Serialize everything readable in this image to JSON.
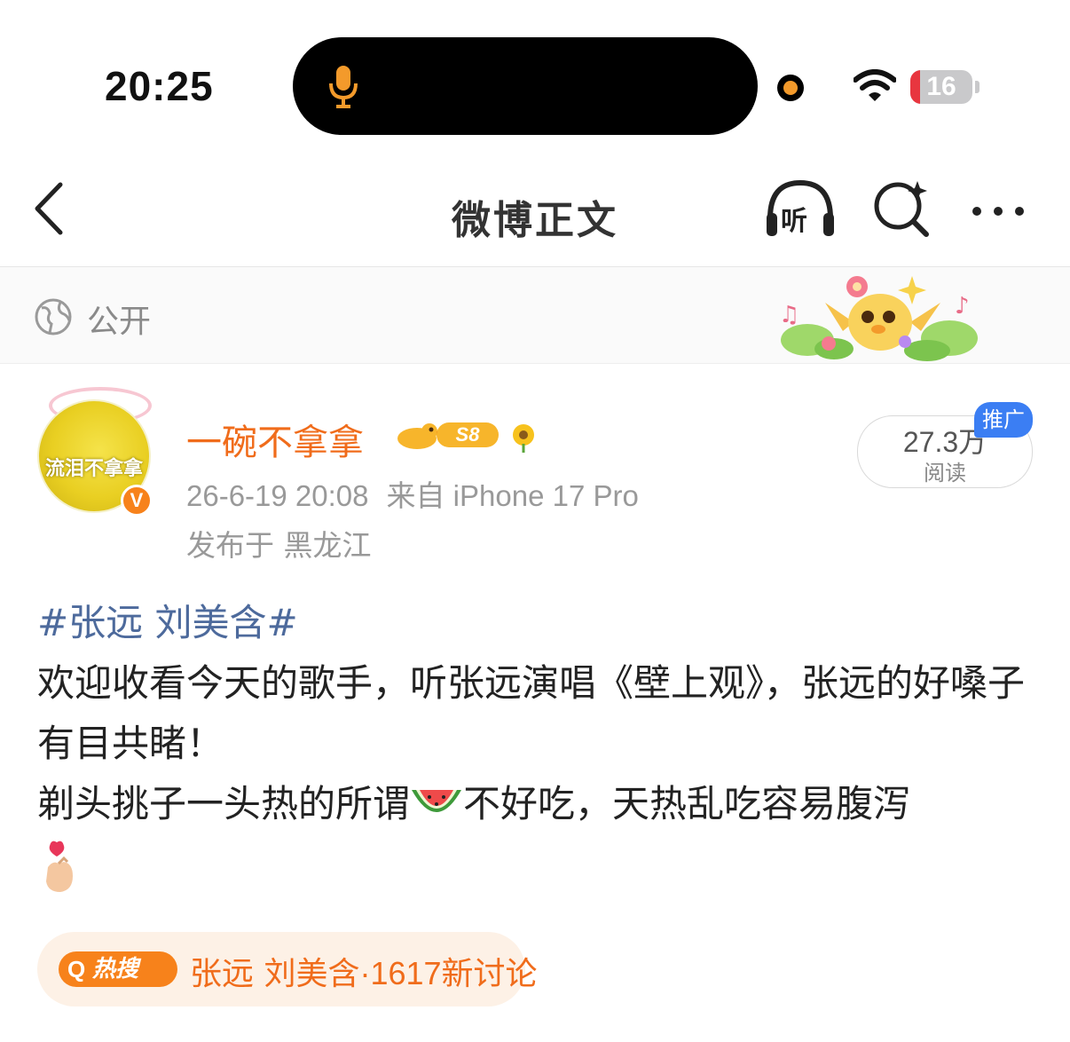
{
  "status_bar": {
    "time": "20:25",
    "battery": "16",
    "battery_percent": 16
  },
  "nav": {
    "title": "微博正文",
    "listen_label": "听"
  },
  "visibility": {
    "label": "公开"
  },
  "author": {
    "avatar_text": "流泪不拿拿",
    "name": "一碗不拿拿",
    "level": "S8",
    "verified_mark": "V",
    "date": "26-6-19 20:08",
    "source": "来自 iPhone 17 Pro",
    "location": "发布于 黑龙江"
  },
  "reads": {
    "count": "27.3万",
    "label": "阅读",
    "promo": "推广"
  },
  "post": {
    "topic": "#张远 刘美含#",
    "line1": "欢迎收看今天的歌手，听张远演唱《壁上观》，张远的好嗓子有目共睹！",
    "line2_a": "剃头挑子一头热的所谓",
    "line2_b": "不好吃，天热乱吃容易腹泻"
  },
  "hot_search": {
    "badge": "热搜",
    "topic": "张远 刘美含",
    "count": "·1617新讨论"
  },
  "colors": {
    "accent": "#f06c1b",
    "topic": "#4d6a9c",
    "promo_blue": "#3b7ef3"
  },
  "icons": [
    "microphone-icon",
    "wifi-icon",
    "back-icon",
    "headphones-icon",
    "search-icon",
    "more-icon",
    "globe-icon",
    "watermelon-emoji",
    "finger-heart-emoji"
  ]
}
